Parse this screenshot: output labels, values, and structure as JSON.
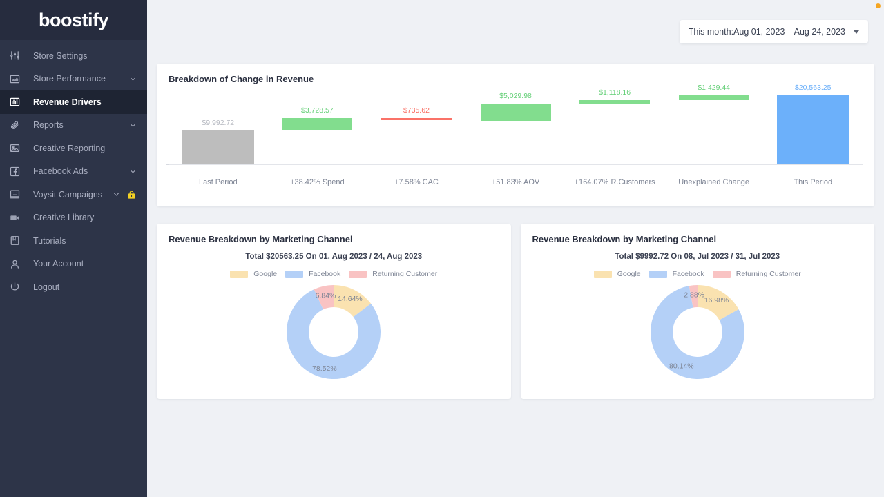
{
  "brand": {
    "name": "boostify"
  },
  "sidebar": {
    "items": [
      {
        "label": "Store Settings",
        "icon": "sliders-icon",
        "name": "store-settings",
        "chevron": false,
        "lock": false,
        "active": false
      },
      {
        "label": "Store Performance",
        "icon": "area-chart-icon",
        "name": "store-performance",
        "chevron": true,
        "lock": false,
        "active": false
      },
      {
        "label": "Revenue Drivers",
        "icon": "bar-chart-icon",
        "name": "revenue-drivers",
        "chevron": false,
        "lock": false,
        "active": true
      },
      {
        "label": "Reports",
        "icon": "paperclip-icon",
        "name": "reports",
        "chevron": true,
        "lock": false,
        "active": false
      },
      {
        "label": "Creative Reporting",
        "icon": "image-icon",
        "name": "creative-reporting",
        "chevron": false,
        "lock": false,
        "active": false
      },
      {
        "label": "Facebook Ads",
        "icon": "facebook-icon",
        "name": "facebook-ads",
        "chevron": true,
        "lock": false,
        "active": false
      },
      {
        "label": "Voysit Campaigns",
        "icon": "monitor-icon",
        "name": "voysit-campaigns",
        "chevron": true,
        "lock": true,
        "active": false
      },
      {
        "label": "Creative Library",
        "icon": "video-camera-icon",
        "name": "creative-library",
        "chevron": false,
        "lock": false,
        "active": false
      },
      {
        "label": "Tutorials",
        "icon": "book-icon",
        "name": "tutorials",
        "chevron": false,
        "lock": false,
        "active": false
      },
      {
        "label": "Your Account",
        "icon": "user-icon",
        "name": "your-account",
        "chevron": false,
        "lock": false,
        "active": false
      },
      {
        "label": "Logout",
        "icon": "power-icon",
        "name": "logout",
        "chevron": false,
        "lock": false,
        "active": false
      }
    ]
  },
  "topbar": {
    "date_range_label": "This month:Aug 01, 2023 – Aug 24, 2023",
    "caret_icon": "chevron-down-icon",
    "notification_dot_color": "#f5a623"
  },
  "chart_data": [
    {
      "type": "bar",
      "subtype": "waterfall",
      "title": "Breakdown of Change in Revenue",
      "xlabel": "",
      "ylabel": "",
      "grid": false,
      "ylim": [
        0,
        20563.25
      ],
      "categories": [
        "Last Period",
        "+38.42% Spend",
        "+7.58% CAC",
        "+51.83% AOV",
        "+164.07% R.Customers",
        "Unexplained Change",
        "This Period"
      ],
      "value_labels": [
        "$9,992.72",
        "$3,728.57",
        "$735.62",
        "$5,029.98",
        "$1,118.16",
        "$1,429.44",
        "$20,563.25"
      ],
      "values": [
        9992.72,
        3728.57,
        -735.62,
        5029.98,
        1118.16,
        1429.44,
        20563.25
      ],
      "bar_kinds": [
        "total-start",
        "increase",
        "decrease",
        "increase",
        "increase",
        "increase",
        "total-end"
      ],
      "bar_base": [
        0,
        9992.72,
        13721.29,
        12985.67,
        18015.65,
        19133.81,
        0
      ],
      "bar_top": [
        9992.72,
        13721.29,
        12985.67,
        18015.65,
        19133.81,
        20563.25,
        20563.25
      ],
      "colors": {
        "start": "#bdbdbd",
        "increase": "#82dd8e",
        "decrease": "#fa7268",
        "end": "#6cb0fa"
      },
      "label_colors": {
        "start": "#b5b8c0",
        "increase": "#63cf76",
        "decrease": "#f96a5f",
        "end": "#6cb0fa"
      }
    },
    {
      "type": "pie",
      "subtype": "donut",
      "title": "Revenue Breakdown by Marketing Channel",
      "subtitle": "Total $20563.25 On 01, Aug 2023 / 24, Aug 2023",
      "legend_position": "top",
      "labels": [
        "Google",
        "Facebook",
        "Returning Customer"
      ],
      "values": [
        14.64,
        78.52,
        6.84
      ],
      "value_labels": [
        "14.64%",
        "78.52%",
        "6.84%"
      ],
      "colors": [
        "#fae2b0",
        "#b4d0f7",
        "#f9c3c3"
      ]
    },
    {
      "type": "pie",
      "subtype": "donut",
      "title": "Revenue Breakdown by Marketing Channel",
      "subtitle": "Total $9992.72 On 08, Jul 2023 / 31, Jul 2023",
      "legend_position": "top",
      "labels": [
        "Google",
        "Facebook",
        "Returning Customer"
      ],
      "values": [
        16.98,
        80.14,
        2.88
      ],
      "value_labels": [
        "16.98%",
        "80.14%",
        "2.88%"
      ],
      "colors": [
        "#fae2b0",
        "#b4d0f7",
        "#f9c3c3"
      ]
    }
  ]
}
